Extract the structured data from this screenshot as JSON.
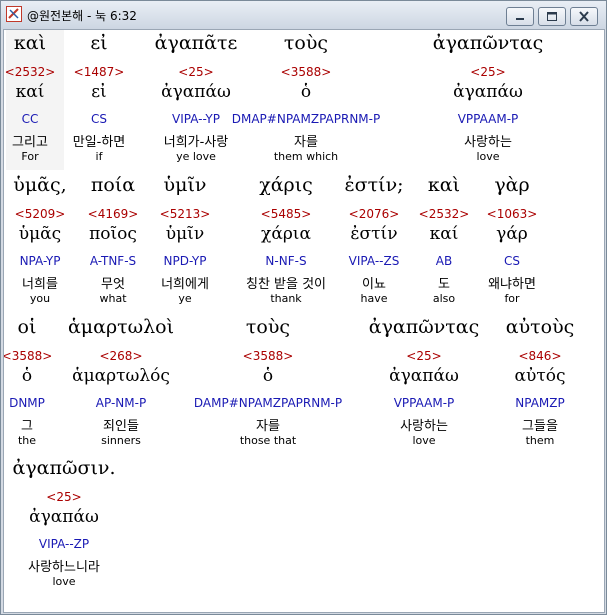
{
  "window": {
    "title": "@원전본해 - 눅 6:32"
  },
  "rows": [
    {
      "words": [
        {
          "greek": "καὶ",
          "strong": "<2532>",
          "lemma": "καί",
          "morph": "CC",
          "kor": "그리고",
          "eng": "For"
        },
        {
          "greek": "εἰ",
          "strong": "<1487>",
          "lemma": "εἰ",
          "morph": "CS",
          "kor": "만일-하면",
          "eng": "if"
        },
        {
          "greek": "ἀγαπᾶτε",
          "strong": "<25>",
          "lemma": "ἀγαπάω",
          "morph": "VIPA--YP",
          "kor": "너희가-사랑",
          "eng": "ye love"
        },
        {
          "greek": "τοὺς",
          "strong": "<3588>",
          "lemma": "ὁ",
          "morph": "DMAP#NPAMZPAPRNM-P",
          "kor": "자를",
          "eng": "them which"
        },
        {
          "greek": "ἀγαπῶντας",
          "strong": "<25>",
          "lemma": "ἀγαπάω",
          "morph": "VPPAAM-P",
          "kor": "사랑하는",
          "eng": "love"
        }
      ]
    },
    {
      "words": [
        {
          "greek": "ὑμᾶς,",
          "strong": "<5209>",
          "lemma": "ὑμᾶς",
          "morph": "NPA-YP",
          "kor": "너희를",
          "eng": "you"
        },
        {
          "greek": "ποία",
          "strong": "<4169>",
          "lemma": "ποῖος",
          "morph": "A-TNF-S",
          "kor": "무엇",
          "eng": "what"
        },
        {
          "greek": "ὑμῖν",
          "strong": "<5213>",
          "lemma": "ὑμῖν",
          "morph": "NPD-YP",
          "kor": "너희에게",
          "eng": "ye"
        },
        {
          "greek": "χάρις",
          "strong": "<5485>",
          "lemma": "χάρια",
          "morph": "N-NF-S",
          "kor": "칭찬 받을 것이",
          "eng": "thank"
        },
        {
          "greek": "ἐστίν;",
          "strong": "<2076>",
          "lemma": "ἐστίν",
          "morph": "VIPA--ZS",
          "kor": "이뇨",
          "eng": "have"
        },
        {
          "greek": "καὶ",
          "strong": "<2532>",
          "lemma": "καί",
          "morph": "AB",
          "kor": "도",
          "eng": "also"
        },
        {
          "greek": "γὰρ",
          "strong": "<1063>",
          "lemma": "γάρ",
          "morph": "CS",
          "kor": "왜냐하면",
          "eng": "for"
        }
      ]
    },
    {
      "words": [
        {
          "greek": "οἱ",
          "strong": "<3588>",
          "lemma": "ὁ",
          "morph": "DNMP",
          "kor": "그",
          "eng": "the"
        },
        {
          "greek": "ἁμαρτωλοὶ",
          "strong": "<268>",
          "lemma": "ἁμαρτωλός",
          "morph": "AP-NM-P",
          "kor": "죄인들",
          "eng": "sinners"
        },
        {
          "greek": "τοὺς",
          "strong": "<3588>",
          "lemma": "ὁ",
          "morph": "DAMP#NPAMZPAPRNM-P",
          "kor": "자를",
          "eng": "those that"
        },
        {
          "greek": "ἀγαπῶντας",
          "strong": "<25>",
          "lemma": "ἀγαπάω",
          "morph": "VPPAAM-P",
          "kor": "사랑하는",
          "eng": "love"
        },
        {
          "greek": "αὐτοὺς",
          "strong": "<846>",
          "lemma": "αὐτός",
          "morph": "NPAMZP",
          "kor": "그들을",
          "eng": "them"
        }
      ]
    },
    {
      "words": [
        {
          "greek": "ἀγαπῶσιν.",
          "strong": "<25>",
          "lemma": "ἀγαπάω",
          "morph": "VIPA--ZP",
          "kor": "사랑하느니라",
          "eng": "love"
        }
      ]
    }
  ]
}
